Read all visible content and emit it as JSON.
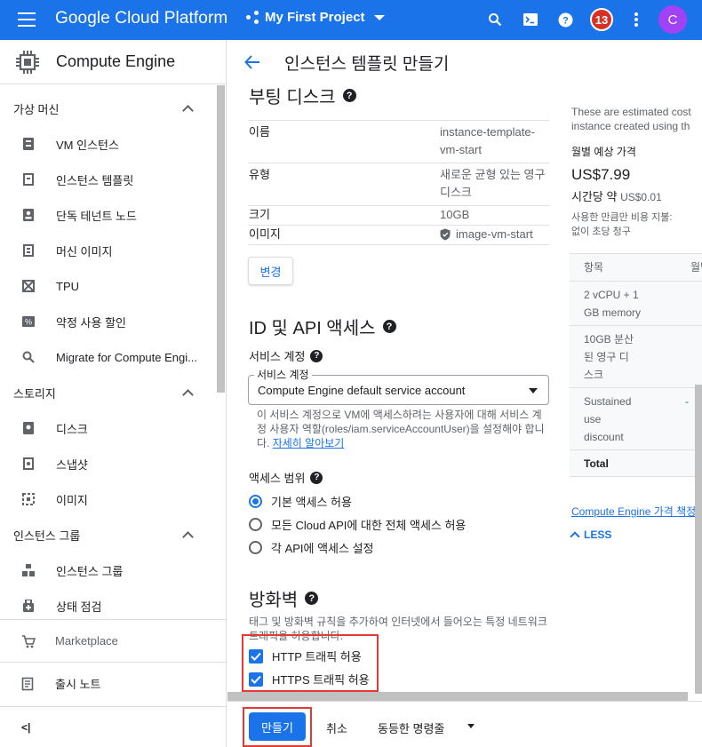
{
  "topbar": {
    "brand": "Google Cloud Platform",
    "project": "My First Project",
    "notification_count": "13",
    "avatar_letter": "C"
  },
  "sidebar": {
    "title": "Compute Engine",
    "sections": [
      {
        "label": "가상 머신",
        "items": [
          {
            "label": "VM 인스턴스",
            "icon": "vm-instance-icon"
          },
          {
            "label": "인스턴스 템플릿",
            "icon": "instance-template-icon"
          },
          {
            "label": "단독 테넌트 노드",
            "icon": "sole-tenant-icon"
          },
          {
            "label": "머신 이미지",
            "icon": "machine-image-icon"
          },
          {
            "label": "TPU",
            "icon": "tpu-icon"
          },
          {
            "label": "약정 사용 할인",
            "icon": "percent-icon"
          },
          {
            "label": "Migrate for Compute Engi...",
            "icon": "search-icon"
          }
        ]
      },
      {
        "label": "스토리지",
        "items": [
          {
            "label": "디스크",
            "icon": "disk-icon"
          },
          {
            "label": "스냅샷",
            "icon": "snapshot-icon"
          },
          {
            "label": "이미지",
            "icon": "image-icon"
          }
        ]
      },
      {
        "label": "인스턴스 그룹",
        "items": [
          {
            "label": "인스턴스 그룹",
            "icon": "instance-group-icon"
          },
          {
            "label": "상태 점검",
            "icon": "health-check-icon"
          }
        ]
      }
    ],
    "marketplace": "Marketplace",
    "release_notes": "출시 노트",
    "collapse": "<|"
  },
  "header": {
    "title": "인스턴스 템플릿 만들기"
  },
  "boot_disk": {
    "heading": "부팅 디스크",
    "rows": [
      {
        "key": "이름",
        "value": "instance-template-vm-start"
      },
      {
        "key": "유형",
        "value": "새로운 균형 있는 영구 디스크"
      },
      {
        "key": "크기",
        "value": "10GB"
      },
      {
        "key": "이미지",
        "value": "image-vm-start"
      }
    ],
    "change_button": "변경"
  },
  "identity": {
    "heading": "ID 및 API 액세스",
    "service_account_label": "서비스 계정",
    "select_legend": "서비스 계정",
    "select_value": "Compute Engine default service account",
    "helper": "이 서비스 계정으로 VM에 액세스하려는 사용자에 대해 서비스 계정 사용자 역할(roles/iam.serviceAccountUser)을 설정해야 합니다.",
    "helper_link": "자세히 알아보기",
    "scope_label": "액세스 범위",
    "scopes": [
      {
        "label": "기본 액세스 허용",
        "selected": true
      },
      {
        "label": "모든 Cloud API에 대한 전체 액세스 허용",
        "selected": false
      },
      {
        "label": "각 API에 액세스 설정",
        "selected": false
      }
    ]
  },
  "firewall": {
    "heading": "방화벽",
    "description": "태그 및 방화벽 규칙을 추가하여 인터넷에서 들어오는 특정 네트워크 트래픽을 허용합니다.",
    "http": "HTTP 트래픽 허용",
    "https": "HTTPS 트래픽 허용"
  },
  "pricing": {
    "note_line1": "These are estimated cost",
    "note_line2": "instance created using th",
    "monthly_label": "월별 예상 가격",
    "amount": "US$7.99",
    "hourly_prefix": "시간당 약",
    "hourly_value": "US$0.01",
    "usage_line1": "사용한 만큼만 비용 지불:",
    "usage_line2": "없이 초당 청구",
    "table_header": [
      "항목",
      "월별 예"
    ],
    "rows": [
      {
        "item": "2 vCPU + 1 GB memory",
        "value": ""
      },
      {
        "item": "10GB 분산된 영구 디스크",
        "value": ""
      },
      {
        "item": "Sustained use discount",
        "value": "-"
      },
      {
        "item": "Total",
        "value": ""
      }
    ],
    "price_link": "Compute Engine 가격 책정",
    "less": "LESS"
  },
  "actions": {
    "create": "만들기",
    "cancel": "취소",
    "equivalent": "동등한 명령줄"
  },
  "colors": {
    "primary": "#1a73e8",
    "highlight": "#e53935",
    "badge": "#d93025",
    "avatar": "#a142f4"
  }
}
